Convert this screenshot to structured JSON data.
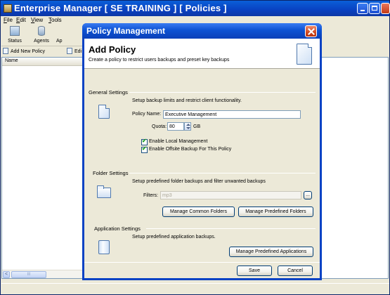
{
  "main_window": {
    "title": "Enterprise Manager [ SE TRAINING ]  [ Policies ]",
    "menu": [
      {
        "label": "File",
        "mnemonic": "F",
        "rest": "ile"
      },
      {
        "label": "Edit",
        "mnemonic": "E",
        "rest": "dit"
      },
      {
        "label": "View",
        "mnemonic": "V",
        "rest": "iew"
      },
      {
        "label": "Tools",
        "mnemonic": "T",
        "rest": "ools"
      }
    ],
    "toolbar": {
      "status_label": "Status",
      "agents_label": "Agents",
      "partial_label": "Ap"
    },
    "toolbar2": {
      "add_new_policy_label": "Add New Policy",
      "edit_partial_label": "Edi"
    },
    "list": {
      "column_name": "Name",
      "scroll_left_glyph": "<",
      "scroll_thumb_grip": "III"
    }
  },
  "dialog": {
    "title": "Policy Management",
    "heading": "Add Policy",
    "subtitle": "Create a policy to restrict users backups and preset key backups",
    "general": {
      "title": "General Settings",
      "description": "Setup backup limits and restrict client functionality.",
      "policy_name_label": "Policy Name:",
      "policy_name_value": "Executive Management",
      "quota_label": "Quota:",
      "quota_value": "80",
      "quota_unit": "GB",
      "enable_local_label": "Enable Local Management",
      "enable_local_checked": true,
      "enable_offsite_label": "Enable Offsite Backup For This Policy",
      "enable_offsite_checked": true
    },
    "folder": {
      "title": "Folder Settings",
      "description": "Setup predefined folder backups and filter unwanted backups",
      "filters_label": "Filters:",
      "filters_value": "mp3",
      "browse_label": "...",
      "manage_common_label": "Manage Common Folders",
      "manage_predefined_label": "Manage Predefined Folders"
    },
    "application": {
      "title": "Application Settings",
      "description": "Setup predefined application backups.",
      "manage_apps_label": "Manage Predefined Applications"
    },
    "save_label": "Save",
    "cancel_label": "Cancel"
  }
}
